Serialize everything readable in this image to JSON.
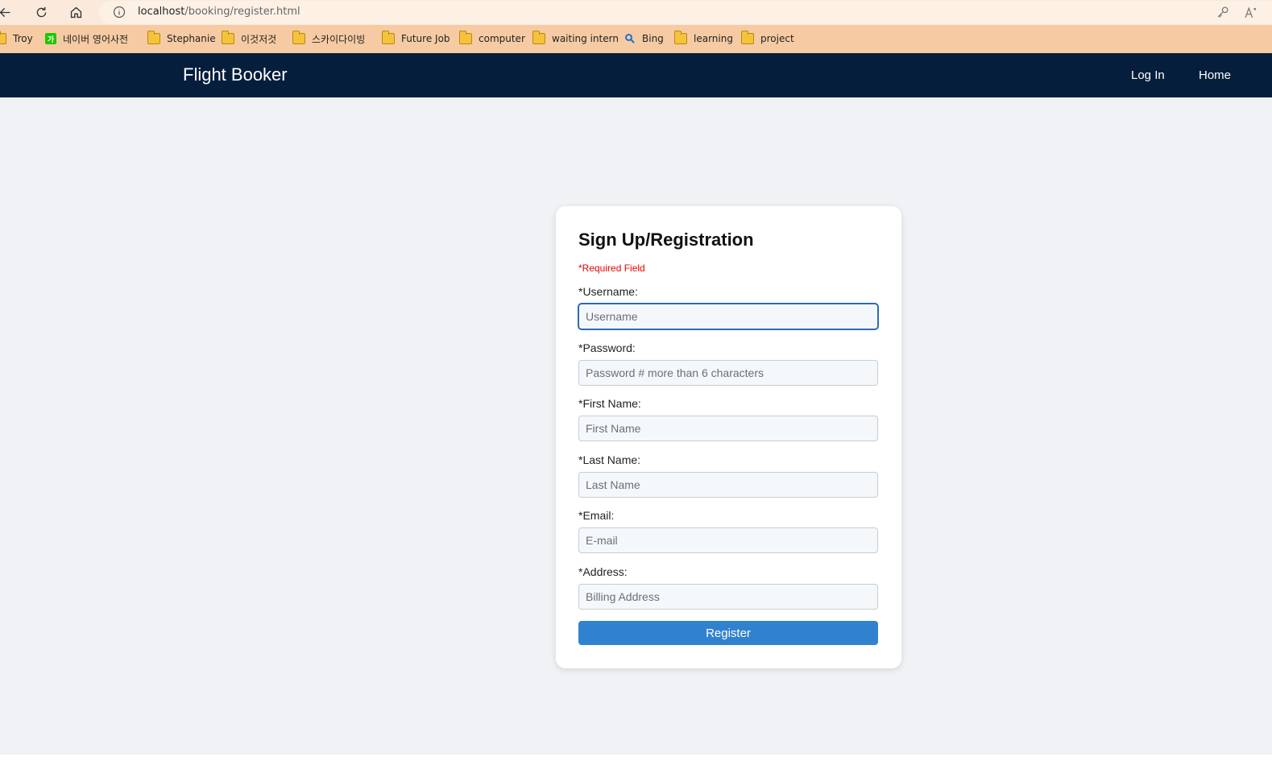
{
  "browser": {
    "url_host": "localhost",
    "url_path": "/booking/register.html",
    "bookmarks": [
      {
        "label": "Troy",
        "icon": "folder-icon"
      },
      {
        "label": "네이버 영어사전",
        "icon": "naver-icon",
        "icon_text": "가"
      },
      {
        "label": "Stephanie",
        "icon": "folder-icon"
      },
      {
        "label": "이것저것",
        "icon": "folder-icon"
      },
      {
        "label": "스카이다이빙",
        "icon": "folder-icon"
      },
      {
        "label": "Future Job",
        "icon": "folder-icon"
      },
      {
        "label": "computer",
        "icon": "folder-icon"
      },
      {
        "label": "waiting intern",
        "icon": "folder-icon"
      },
      {
        "label": "Bing",
        "icon": "search-icon"
      },
      {
        "label": "learning",
        "icon": "folder-icon"
      },
      {
        "label": "project",
        "icon": "folder-icon"
      }
    ]
  },
  "navbar": {
    "brand": "Flight Booker",
    "links": [
      "Log In",
      "Home"
    ],
    "bg_color": "#041e3c"
  },
  "form": {
    "title": "Sign Up/Registration",
    "required_note": "*Required Field",
    "fields": [
      {
        "label": "*Username:",
        "placeholder": "Username",
        "value": ""
      },
      {
        "label": "*Password:",
        "placeholder": "Password # more than 6 characters",
        "value": ""
      },
      {
        "label": "*First Name:",
        "placeholder": "First Name",
        "value": ""
      },
      {
        "label": "*Last Name:",
        "placeholder": "Last Name",
        "value": ""
      },
      {
        "label": "*Email:",
        "placeholder": "E-mail",
        "value": ""
      },
      {
        "label": "*Address:",
        "placeholder": "Billing Address",
        "value": ""
      }
    ],
    "submit_label": "Register",
    "accent_color": "#3182ce"
  }
}
